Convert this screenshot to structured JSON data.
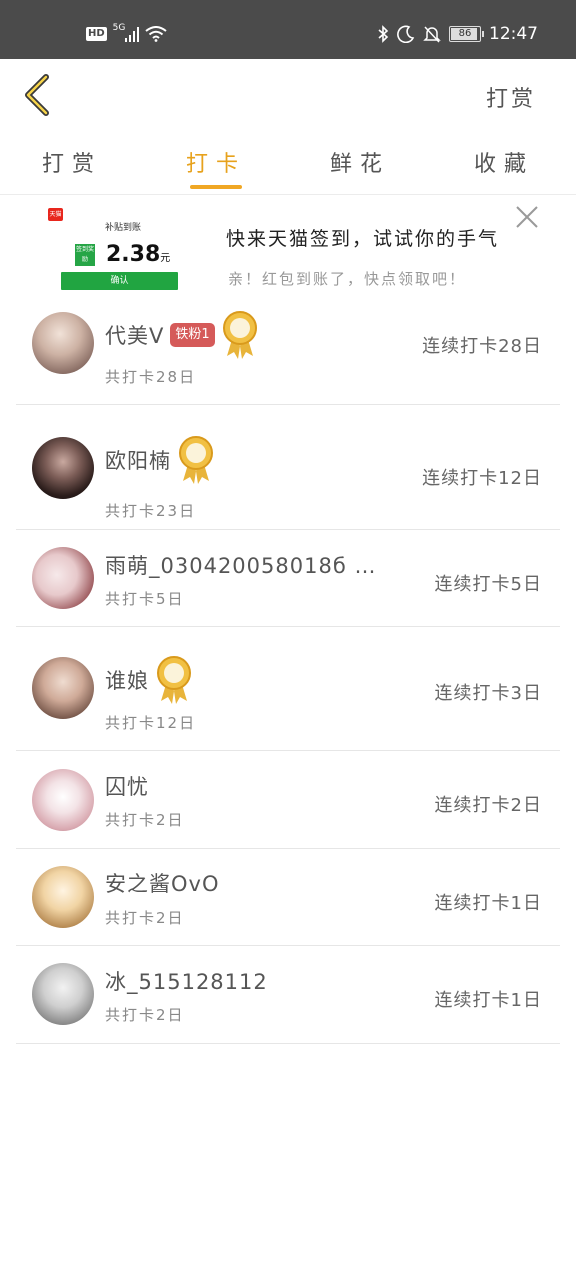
{
  "status_bar": {
    "left_badges": [
      "HD",
      "5G"
    ],
    "battery": "86",
    "time": "12:47"
  },
  "navbar": {
    "back_icon": "chevron-left-icon",
    "right_link": "打赏"
  },
  "tabs": [
    {
      "label": "打赏",
      "active": false
    },
    {
      "label": "打卡",
      "active": true
    },
    {
      "label": "鲜花",
      "active": false
    },
    {
      "label": "收藏",
      "active": false
    }
  ],
  "ad": {
    "brand": "天猫",
    "subtitle": "补贴到账",
    "badge": "签到奖励",
    "amount": "2.38",
    "currency": "元",
    "confirm": "确认",
    "title": "快来天猫签到，试试你的手气",
    "desc": "亲！红包到账了，快点领取吧！"
  },
  "checkins": [
    {
      "name": "代美V",
      "fan_badge": "铁粉1",
      "medal": true,
      "total": "共打卡28日",
      "streak": "连续打卡28日"
    },
    {
      "name": "欧阳楠",
      "fan_badge": "",
      "medal": true,
      "total": "共打卡23日",
      "streak": "连续打卡12日"
    },
    {
      "name": "雨萌_030420058018б …",
      "fan_badge": "",
      "medal": false,
      "total": "共打卡5日",
      "streak": "连续打卡5日"
    },
    {
      "name": "谁娘",
      "fan_badge": "",
      "medal": true,
      "total": "共打卡12日",
      "streak": "连续打卡3日"
    },
    {
      "name": "囚忧",
      "fan_badge": "",
      "medal": false,
      "total": "共打卡2日",
      "streak": "连续打卡2日"
    },
    {
      "name": "安之酱OvO",
      "fan_badge": "",
      "medal": false,
      "total": "共打卡2日",
      "streak": "连续打卡1日"
    },
    {
      "name": "冰_515128112",
      "fan_badge": "",
      "medal": false,
      "total": "共打卡2日",
      "streak": "连续打卡1日"
    }
  ],
  "colors": {
    "accent": "#f0a724",
    "fan_badge": "#d55a59",
    "status_bar": "#4b4b4b"
  }
}
